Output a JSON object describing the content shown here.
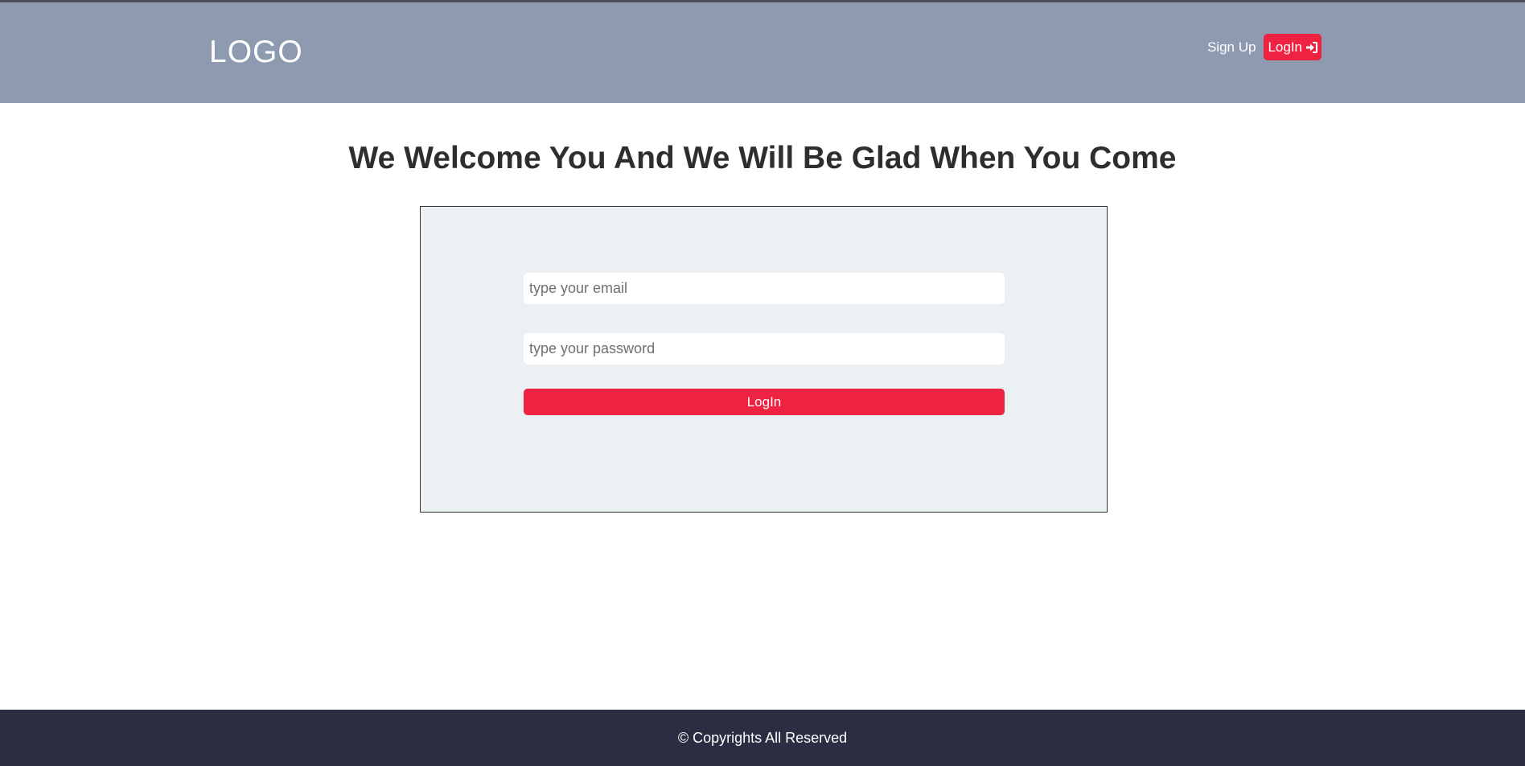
{
  "header": {
    "logo": "LOGO",
    "nav": {
      "signup_label": "Sign Up",
      "login_label": "LogIn",
      "login_icon": "sign-in-icon"
    }
  },
  "main": {
    "title": "We Welcome You And We Will Be Glad When You Come",
    "form": {
      "email_placeholder": "type your email",
      "email_value": "",
      "password_placeholder": "type your password",
      "password_value": "",
      "submit_label": "LogIn"
    }
  },
  "footer": {
    "copyright": "© Copyrights All Reserved"
  },
  "colors": {
    "header_bg": "#8d9ab0",
    "accent": "#ee2241",
    "panel_bg": "#ebf0f3",
    "footer_bg": "#2b2d42",
    "title_text": "#2e2e2e"
  }
}
